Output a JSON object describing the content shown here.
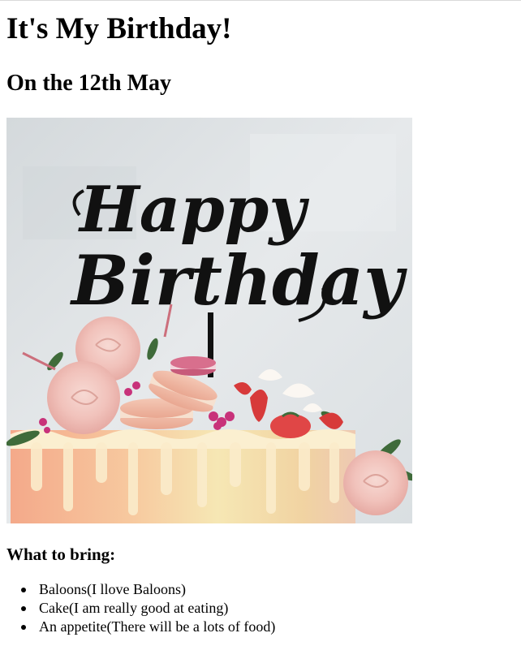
{
  "page": {
    "title": "It's My Birthday!",
    "subtitle": "On the 12th May",
    "image": {
      "alt": "Birthday cake with a Happy Birthday topper, macarons, strawberries and flowers",
      "topper_text_1": "Happy",
      "topper_text_2": "Birthday"
    },
    "bring_heading": "What to bring:",
    "bring_items": [
      "Baloons(I llove Baloons)",
      "Cake(I am really good at eating)",
      "An appetite(There will be a lots of food)"
    ]
  },
  "colors": {
    "text": "#000000",
    "background": "#ffffff"
  }
}
